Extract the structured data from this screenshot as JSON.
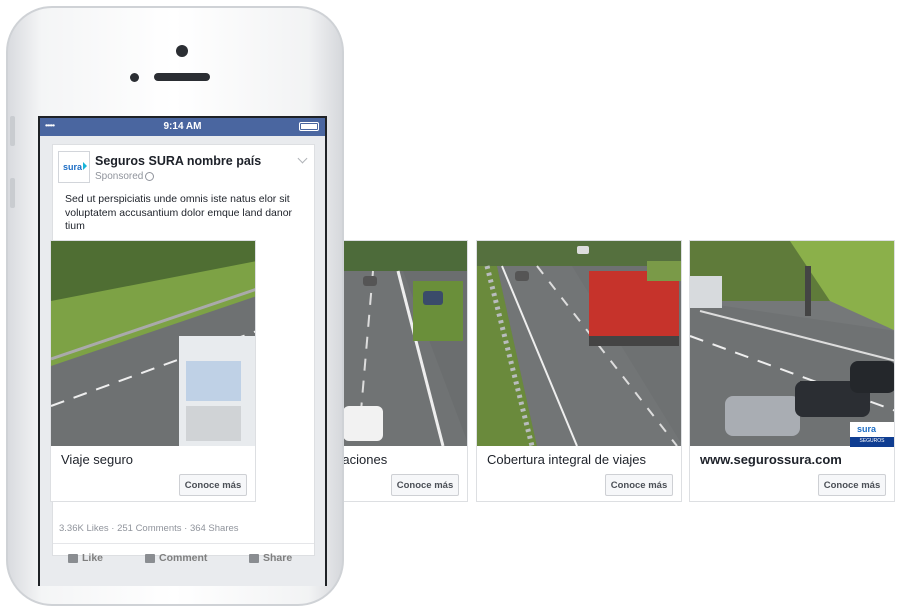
{
  "statusbar": {
    "signal": "•••••",
    "time": "9:14 AM"
  },
  "post": {
    "logo_text": "sura",
    "page_name": "Seguros SURA nombre país",
    "sponsored": "Sponsored",
    "text": "Sed ut perspiciatis unde omnis iste natus elor sit voluptatem accusantium dolor emque land danor tium",
    "engagement": "3.36K Likes · 251 Comments · 364 Shares",
    "actions": {
      "like": "Like",
      "comment": "Comment",
      "share": "Share"
    }
  },
  "cards": [
    {
      "title": "Viaje seguro",
      "cta": "Conoce más"
    },
    {
      "title": "Sin preocupaciones",
      "cta": "Conoce más"
    },
    {
      "title": "Cobertura integral de viajes",
      "cta": "Conoce más"
    },
    {
      "title": "www.segurossura.com",
      "cta": "Conoce más",
      "badge_logo": "sura",
      "badge_sub": "SEGUROS"
    }
  ],
  "colors": {
    "facebook_blue": "#4a66a0",
    "sura_blue": "#1c6dc5",
    "sura_cyan": "#18b4d8"
  }
}
